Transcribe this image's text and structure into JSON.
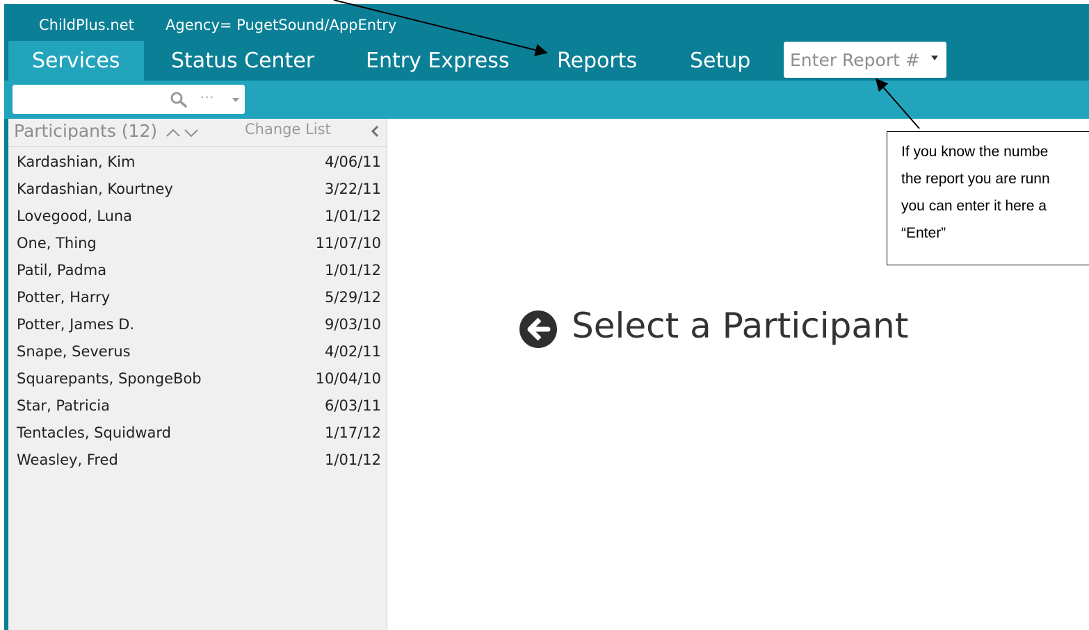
{
  "header": {
    "brand": "ChildPlus.net",
    "agency": "Agency= PugetSound/AppEntry",
    "tabs": [
      {
        "label": "Services",
        "active": true
      },
      {
        "label": "Status Center",
        "active": false
      },
      {
        "label": "Entry Express",
        "active": false
      },
      {
        "label": "Reports",
        "active": false
      },
      {
        "label": "Setup",
        "active": false
      }
    ],
    "report_input_placeholder": "Enter Report #"
  },
  "search": {
    "value": "",
    "more_label": "···"
  },
  "participants": {
    "title": "Participants (12)",
    "change_list": "Change List",
    "items": [
      {
        "name": "Kardashian, Kim",
        "date": "4/06/11"
      },
      {
        "name": "Kardashian, Kourtney",
        "date": "3/22/11"
      },
      {
        "name": "Lovegood, Luna",
        "date": "1/01/12"
      },
      {
        "name": "One, Thing",
        "date": "11/07/10"
      },
      {
        "name": "Patil, Padma",
        "date": "1/01/12"
      },
      {
        "name": "Potter, Harry",
        "date": "5/29/12"
      },
      {
        "name": "Potter, James D.",
        "date": "9/03/10"
      },
      {
        "name": "Snape, Severus",
        "date": "4/02/11"
      },
      {
        "name": "Squarepants, SpongeBob",
        "date": "10/04/10"
      },
      {
        "name": "Star, Patricia",
        "date": "6/03/11"
      },
      {
        "name": "Tentacles, Squidward",
        "date": "1/17/12"
      },
      {
        "name": "Weasley, Fred",
        "date": "1/01/12"
      }
    ]
  },
  "main": {
    "select_message": "Select a Participant"
  },
  "callout": {
    "lines": [
      "If you know the numbe",
      "the report you are runn",
      "you can enter it here a",
      "“Enter”"
    ]
  },
  "colors": {
    "topbar": "#0b7f96",
    "subbar": "#22a4bd",
    "active_tab": "#22a4bd",
    "panel_bg": "#f0f0f0"
  }
}
